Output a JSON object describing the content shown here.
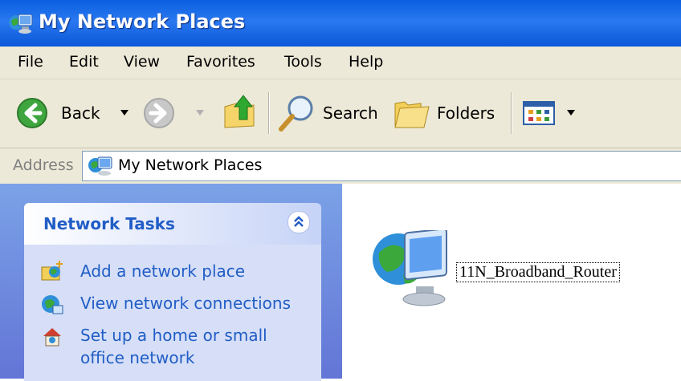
{
  "window": {
    "title": "My Network Places"
  },
  "menu": [
    "File",
    "Edit",
    "View",
    "Favorites",
    "Tools",
    "Help"
  ],
  "toolbar": {
    "back_label": "Back",
    "search_label": "Search",
    "folders_label": "Folders"
  },
  "address": {
    "label": "Address",
    "value": "My Network Places"
  },
  "network_tasks": {
    "title": "Network Tasks",
    "items": [
      {
        "label": "Add a network place",
        "icon": "add-network-place-icon"
      },
      {
        "label": "View network connections",
        "icon": "network-connections-icon"
      },
      {
        "label_line1": "Set up a home or small",
        "label_line2": "office network",
        "icon": "home-network-icon"
      }
    ]
  },
  "content": {
    "item_label": "11N_Broadband_Router",
    "item_icon": "network-computer-icon"
  }
}
